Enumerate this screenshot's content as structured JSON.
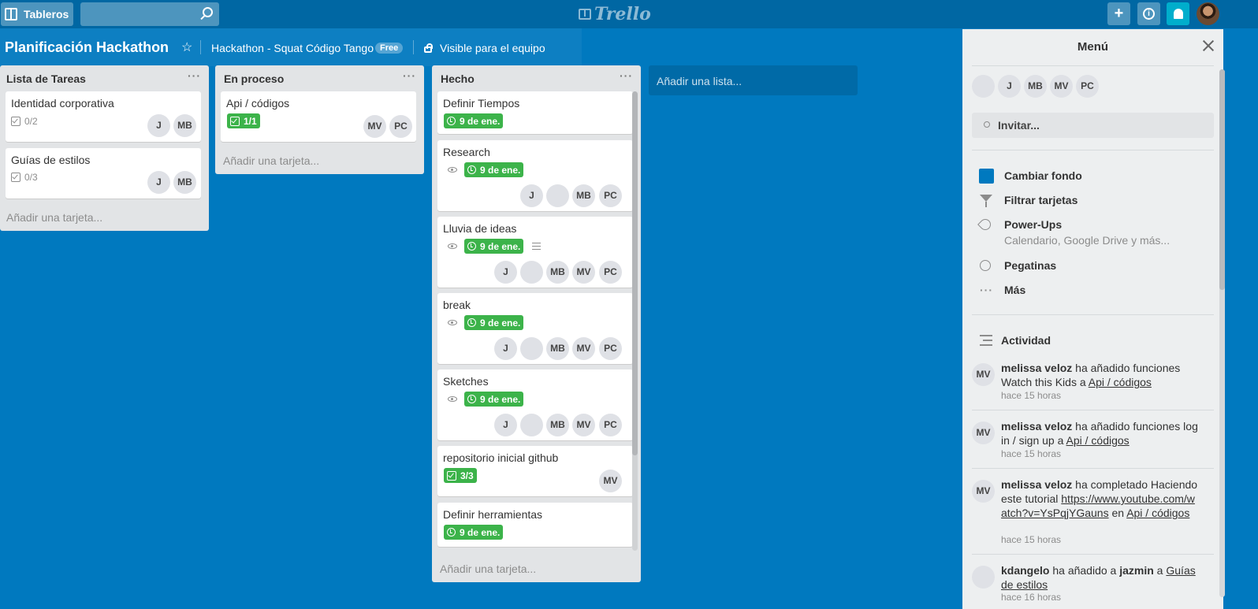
{
  "topbar": {
    "boards_label": "Tableros",
    "logo": "Trello",
    "search_value": ""
  },
  "board": {
    "title": "Planificación Hackathon",
    "team": "Hackathon - Squat Código Tango",
    "team_badge": "Free",
    "visibility": "Visible para el equipo"
  },
  "lists": [
    {
      "title": "Lista de Tareas",
      "add_card": "Añadir una tarjeta...",
      "cards": [
        {
          "title": "Identidad corporativa",
          "checklist": "0/2",
          "members": [
            "J",
            "MB"
          ]
        },
        {
          "title": "Guías de estilos",
          "checklist": "0/3",
          "members": [
            "J",
            "MB"
          ]
        }
      ]
    },
    {
      "title": "En proceso",
      "add_card": "Añadir una tarjeta...",
      "cards": [
        {
          "title": "Api / códigos",
          "checklist": "1/1",
          "members": [
            "MV",
            "PC"
          ]
        }
      ]
    },
    {
      "title": "Hecho",
      "add_card": "Añadir una tarjeta...",
      "cards": [
        {
          "title": "Definir Tiempos",
          "due": "9 de ene."
        },
        {
          "title": "Research",
          "due": "9 de ene.",
          "members": [
            "J",
            "MB",
            "PC"
          ]
        },
        {
          "title": "Lluvia de ideas",
          "due": "9 de ene.",
          "members": [
            "J",
            "MB",
            "MV",
            "PC"
          ]
        },
        {
          "title": "break",
          "due": "9 de ene.",
          "members": [
            "J",
            "MB",
            "MV",
            "PC"
          ]
        },
        {
          "title": "Sketches",
          "due": "9 de ene.",
          "members": [
            "J",
            "MB",
            "MV",
            "PC"
          ]
        },
        {
          "title": "repositorio inicial github",
          "checklist": "3/3",
          "members": [
            "MV"
          ]
        },
        {
          "title": "Definir herramientas",
          "due": "9 de ene."
        }
      ]
    }
  ],
  "add_list": "Añadir una lista...",
  "menu": {
    "title": "Menú",
    "members": [
      "J",
      "MB",
      "MV",
      "PC"
    ],
    "invite": "Invitar...",
    "items": {
      "change_bg": "Cambiar fondo",
      "filter": "Filtrar tarjetas",
      "powerups": "Power-Ups",
      "powerups_sub": "Calendario, Google Drive y más...",
      "stickers": "Pegatinas",
      "more": "Más"
    },
    "activity_title": "Actividad",
    "activity": [
      {
        "avatar": "MV",
        "user": "melissa veloz",
        "pre": " ha añadido funciones Watch this Kids a ",
        "link": "Api / códigos",
        "time": "hace 15 horas"
      },
      {
        "avatar": "MV",
        "user": "melissa veloz",
        "pre": " ha añadido funciones log in / sign up a ",
        "link": "Api / códigos",
        "time": "hace 15 horas"
      },
      {
        "avatar": "MV",
        "user": "melissa veloz",
        "pre": " ha completado Haciendo este tutorial ",
        "link1": "https://www.youtube.com/watch?v=YsPqjYGauns",
        "mid": " en ",
        "link": "Api / códigos",
        "time": "hace 15 horas"
      },
      {
        "user": "kdangelo",
        "pre": " ha añadido a ",
        "user2": "jazmin",
        "mid": " a ",
        "link": "Guías de estilos",
        "time": "hace 16 horas"
      }
    ]
  }
}
